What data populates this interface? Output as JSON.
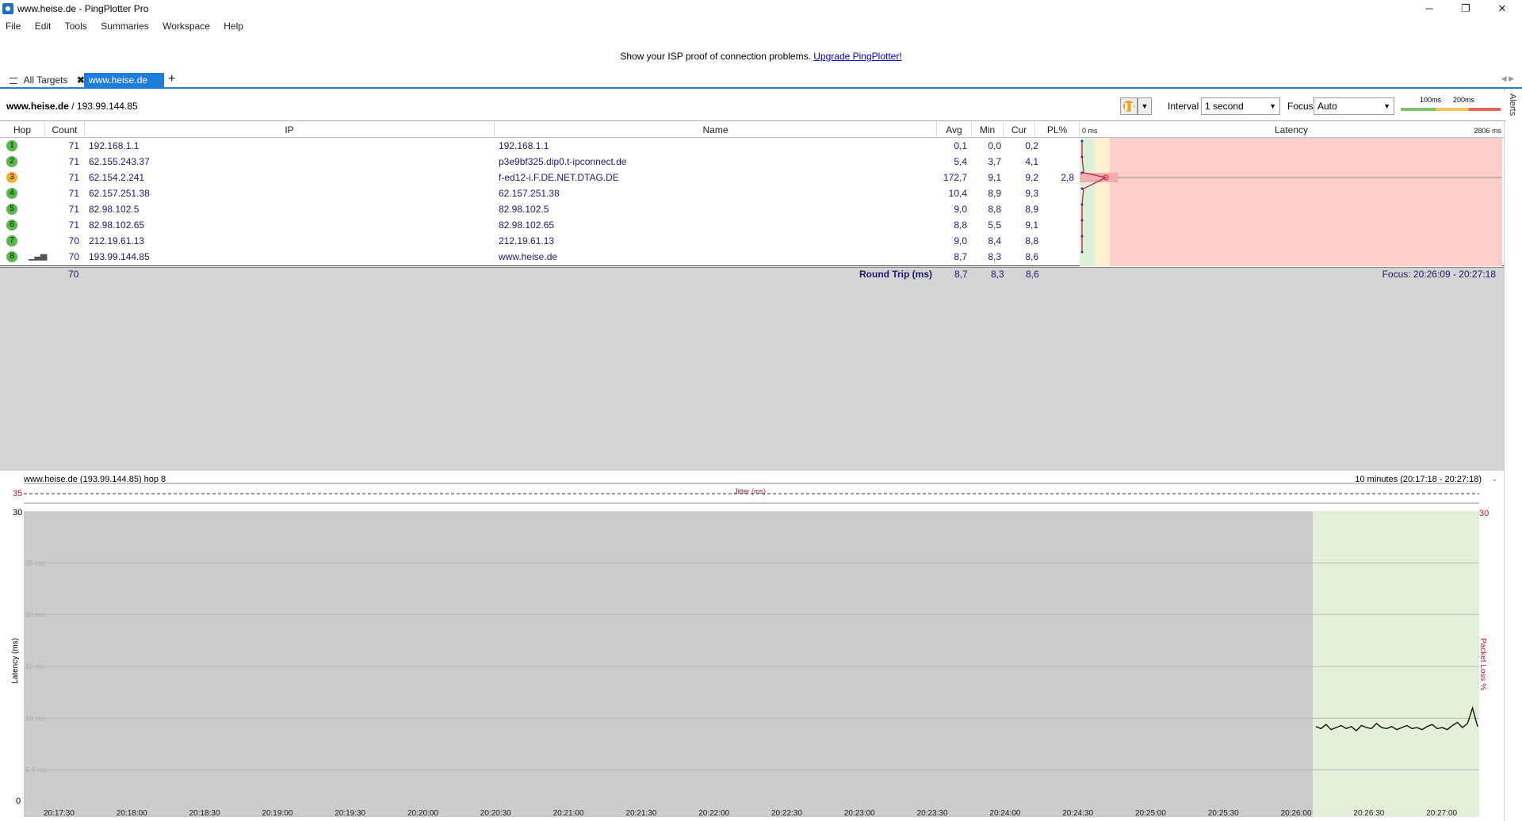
{
  "window": {
    "title": "www.heise.de - PingPlotter Pro",
    "minimize": "─",
    "maximize": "❐",
    "close": "✕"
  },
  "menu": [
    "File",
    "Edit",
    "Tools",
    "Summaries",
    "Workspace",
    "Help"
  ],
  "promo": {
    "text": "Show your ISP proof of connection problems.",
    "link": "Upgrade PingPlotter!"
  },
  "tabs": {
    "all_targets": "All Targets",
    "active": "www.heise.de",
    "add": "+"
  },
  "target_bar": {
    "host": "www.heise.de",
    "ip": " / 193.99.144.85",
    "interval_label": "Interval",
    "interval_value": "1 second",
    "focus_label": "Focus",
    "focus_value": "Auto",
    "scale_100": "100ms",
    "scale_200": "200ms",
    "alerts": "Alerts"
  },
  "table": {
    "headers": {
      "hop": "Hop",
      "count": "Count",
      "ip": "IP",
      "name": "Name",
      "avg": "Avg",
      "min": "Min",
      "cur": "Cur",
      "pl": "PL%",
      "zero": "0 ms",
      "latency": "Latency",
      "max": "2806 ms"
    },
    "rows": [
      {
        "hop": "1",
        "count": "71",
        "ip": "192.168.1.1",
        "name": "192.168.1.1",
        "avg": "0,1",
        "min": "0,0",
        "cur": "0,2",
        "pl": "",
        "status": "ok"
      },
      {
        "hop": "2",
        "count": "71",
        "ip": "62.155.243.37",
        "name": "p3e9bf325.dip0.t-ipconnect.de",
        "avg": "5,4",
        "min": "3,7",
        "cur": "4,1",
        "pl": "",
        "status": "ok"
      },
      {
        "hop": "3",
        "count": "71",
        "ip": "62.154.2.241",
        "name": "f-ed12-i.F.DE.NET.DTAG.DE",
        "avg": "172,7",
        "min": "9,1",
        "cur": "9,2",
        "pl": "2,8",
        "status": "warn"
      },
      {
        "hop": "4",
        "count": "71",
        "ip": "62.157.251.38",
        "name": "62.157.251.38",
        "avg": "10,4",
        "min": "8,9",
        "cur": "9,3",
        "pl": "",
        "status": "ok"
      },
      {
        "hop": "5",
        "count": "71",
        "ip": "82.98.102.5",
        "name": "82.98.102.5",
        "avg": "9,0",
        "min": "8,8",
        "cur": "8,9",
        "pl": "",
        "status": "ok"
      },
      {
        "hop": "6",
        "count": "71",
        "ip": "82.98.102.65",
        "name": "82.98.102.65",
        "avg": "8,8",
        "min": "5,5",
        "cur": "9,1",
        "pl": "",
        "status": "ok"
      },
      {
        "hop": "7",
        "count": "70",
        "ip": "212.19.61.13",
        "name": "212.19.61.13",
        "avg": "9,0",
        "min": "8,4",
        "cur": "8,8",
        "pl": "",
        "status": "ok"
      },
      {
        "hop": "8",
        "count": "70",
        "ip": "193.99.144.85",
        "name": "www.heise.de",
        "avg": "8,7",
        "min": "8,3",
        "cur": "8,6",
        "pl": "",
        "status": "ok"
      }
    ],
    "summary": {
      "count": "70",
      "label": "Round Trip (ms)",
      "avg": "8,7",
      "min": "8,3",
      "cur": "8,6",
      "focus": "Focus: 20:26:09 - 20:27:18"
    }
  },
  "timeline": {
    "header": "www.heise.de (193.99.144.85) hop 8",
    "range": "10 minutes (20:17:18 - 20:27:18)",
    "jitter_label": "Jitter (ms)",
    "jitter_max": "35",
    "y_top": "30",
    "y_zero": "0",
    "y_right_top": "30",
    "y_axis_label": "Latency (ms)",
    "y2_axis_label": "Packet Loss %",
    "gridlines": [
      "25 ms",
      "20 ms",
      "15 ms",
      "10 ms",
      "5,0 ms"
    ],
    "x_ticks": [
      "20:17:30",
      "20:18:00",
      "20:18:30",
      "20:19:00",
      "20:19:30",
      "20:20:00",
      "20:20:30",
      "20:21:00",
      "20:21:30",
      "20:22:00",
      "20:22:30",
      "20:23:00",
      "20:23:30",
      "20:24:00",
      "20:24:30",
      "20:25:00",
      "20:25:30",
      "20:26:00",
      "20:26:30",
      "20:27:00"
    ]
  },
  "colors": {
    "accent": "#1e7dd8",
    "ok": "#58b84b",
    "warn": "#f0b030",
    "latency_bad": "#ffcccc",
    "data_region": "#e2f0d9"
  }
}
